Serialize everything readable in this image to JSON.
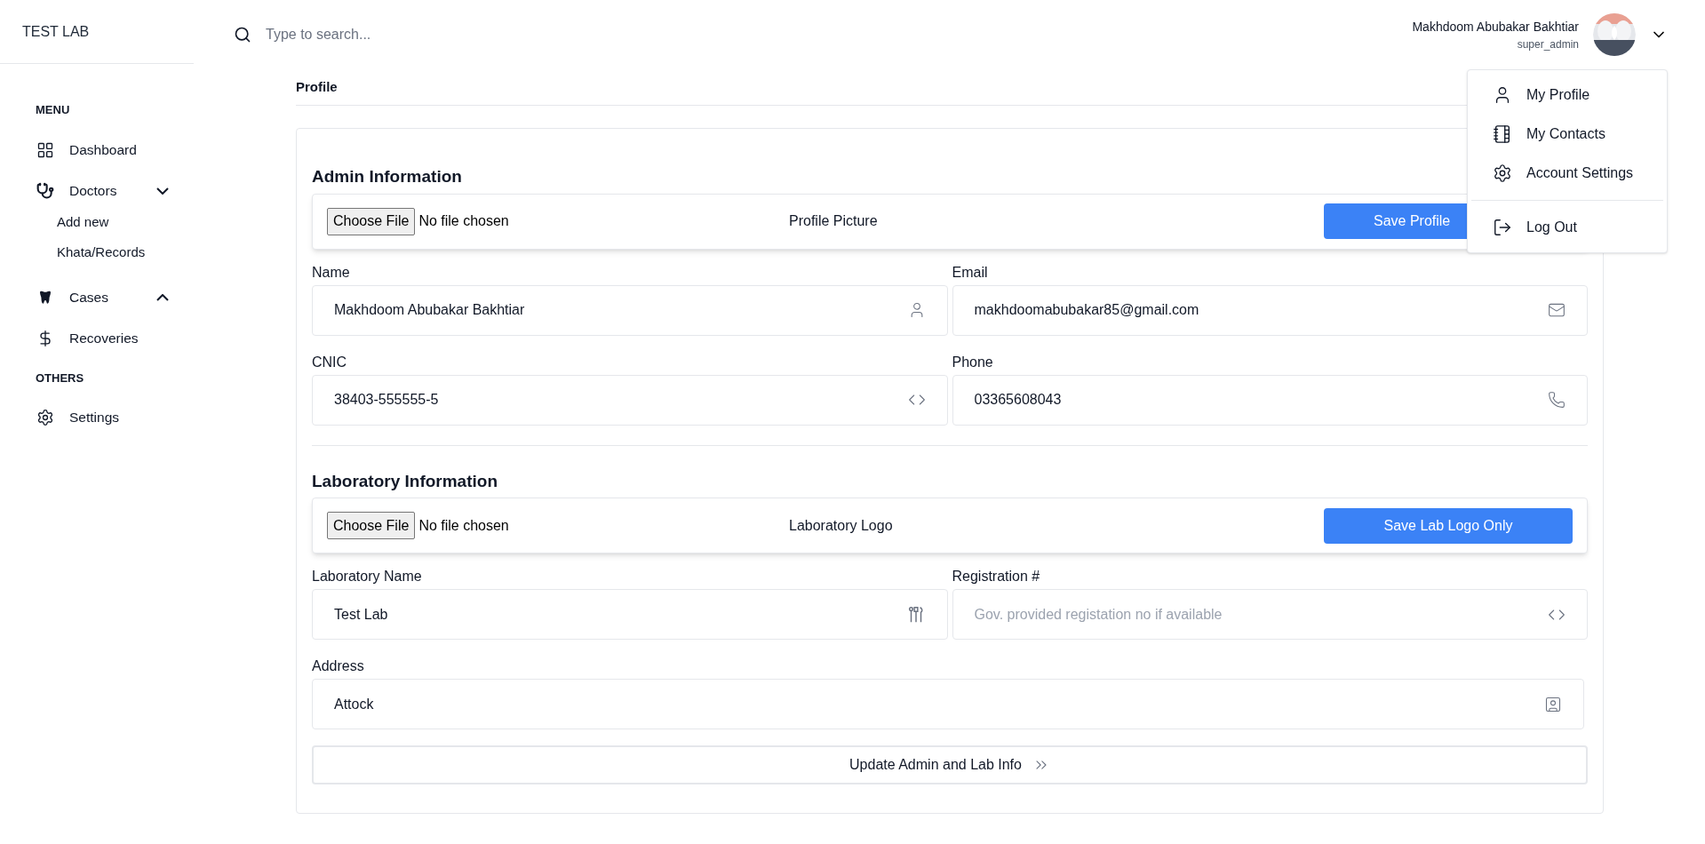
{
  "brand": "TEST LAB",
  "search": {
    "placeholder": "Type to search..."
  },
  "user": {
    "name": "Makhdoom Abubakar Bakhtiar",
    "role": "super_admin"
  },
  "user_menu": {
    "expanded": true,
    "items": [
      {
        "label": "My Profile",
        "kind": "item"
      },
      {
        "label": "My Contacts",
        "kind": "item"
      },
      {
        "label": "Account Settings",
        "kind": "item"
      },
      {
        "label": "Log Out",
        "kind": "logout"
      }
    ]
  },
  "sidebar": {
    "sections": [
      {
        "title": "MENU",
        "items": [
          {
            "label": "Dashboard",
            "expandable": false
          },
          {
            "label": "Doctors",
            "expandable": true,
            "expanded": true,
            "children": [
              {
                "label": "Add new"
              },
              {
                "label": "Khata/Records"
              }
            ]
          },
          {
            "label": "Cases",
            "expandable": true,
            "expanded": false
          },
          {
            "label": "Recoveries",
            "expandable": false
          }
        ]
      },
      {
        "title": "OTHERS",
        "items": [
          {
            "label": "Settings",
            "expandable": false
          }
        ]
      }
    ]
  },
  "breadcrumb": "Profile",
  "sections": [
    {
      "title": "Admin Information",
      "upload": {
        "button": "Choose File",
        "status": "No file chosen",
        "label": "Profile Picture",
        "save": "Save Profile"
      },
      "fields": [
        {
          "label": "Name",
          "value": "Makhdoom Abubakar Bakhtiar",
          "wide": false
        },
        {
          "label": "Email",
          "value": "makhdoomabubakar85@gmail.com",
          "wide": false
        },
        {
          "label": "CNIC",
          "value": "38403-555555-5",
          "wide": false
        },
        {
          "label": "Phone",
          "value": "03365608043",
          "wide": false
        }
      ]
    },
    {
      "title": "Laboratory Information",
      "upload": {
        "button": "Choose File",
        "status": "No file chosen",
        "label": "Laboratory Logo",
        "save": "Save Lab Logo Only"
      },
      "fields": [
        {
          "label": "Laboratory Name",
          "value": "Test Lab",
          "wide": false
        },
        {
          "label": "Registration #",
          "placeholder": "Gov. provided registation no if available",
          "wide": false
        },
        {
          "label": "Address",
          "value": "Attock",
          "wide": true
        }
      ]
    }
  ],
  "submit": "Update Admin and Lab Info"
}
